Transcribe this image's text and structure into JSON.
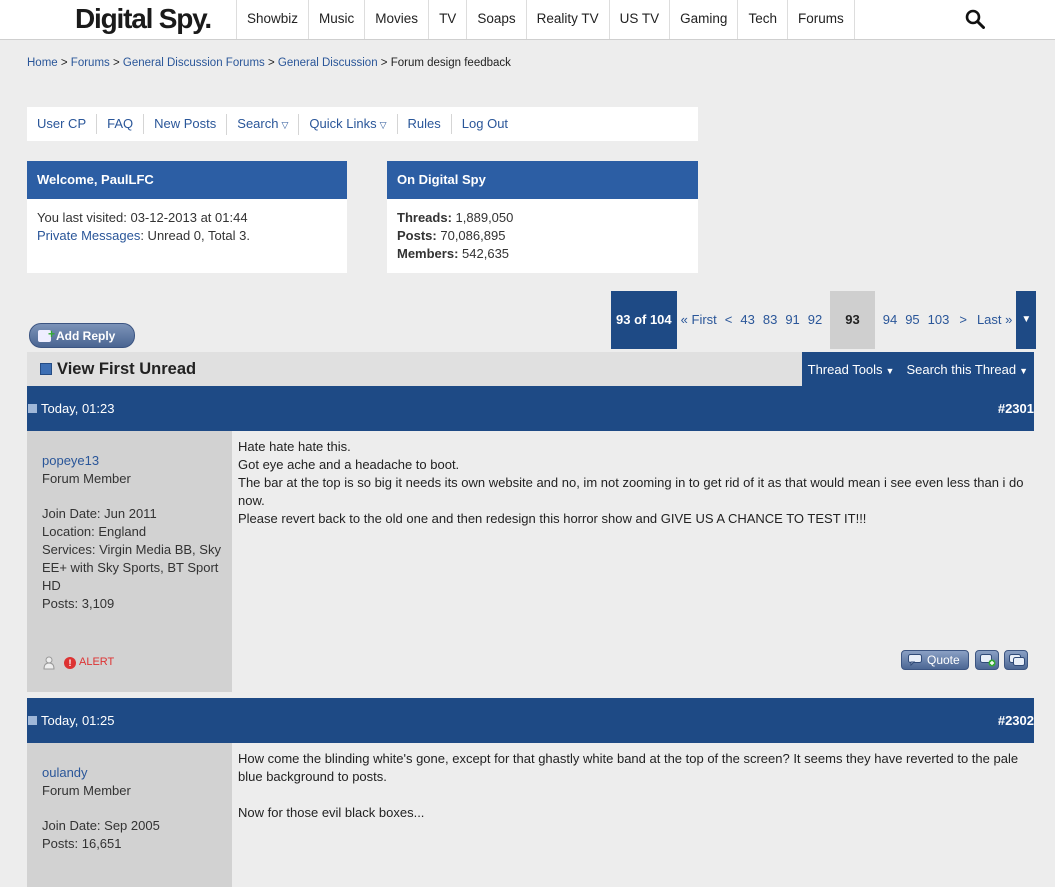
{
  "header": {
    "logo": "Digital Spy.",
    "nav": [
      "Showbiz",
      "Music",
      "Movies",
      "TV",
      "Soaps",
      "Reality TV",
      "US TV",
      "Gaming",
      "Tech",
      "Forums"
    ]
  },
  "breadcrumb": {
    "items": [
      "Home",
      "Forums",
      "General Discussion Forums",
      "General Discussion"
    ],
    "current": "Forum design feedback",
    "sep": " > "
  },
  "usermenu": {
    "items": [
      "User CP",
      "FAQ",
      "New Posts",
      "Search",
      "Quick Links",
      "Rules",
      "Log Out"
    ]
  },
  "welcome": {
    "title": "Welcome, PaulLFC",
    "last_visited_label": "You last visited: ",
    "last_visited": "03-12-2013 at 01:44",
    "pm_label": "Private Messages",
    "pm_value": ": Unread 0, Total 3."
  },
  "stats": {
    "title": "On Digital Spy",
    "threads_label": "Threads:",
    "threads": "1,889,050",
    "posts_label": "Posts:",
    "posts": "70,086,895",
    "members_label": "Members:",
    "members": "542,635"
  },
  "pager": {
    "count": "93 of 104",
    "first": "« First",
    "prev": "<",
    "pages_before": [
      "43",
      "83",
      "91",
      "92"
    ],
    "current": "93",
    "pages_after": [
      "94",
      "95",
      "103"
    ],
    "next": ">",
    "last": "Last »"
  },
  "add_reply": "Add Reply",
  "view_first_unread": "View First Unread",
  "tools": {
    "thread_tools": "Thread Tools",
    "search_thread": "Search this Thread"
  },
  "posts": [
    {
      "time": "Today, 01:23",
      "num": "#2301",
      "user": "popeye13",
      "rank": "Forum Member",
      "info": [
        "Join Date: Jun 2011",
        "Location: England",
        "Services: Virgin Media BB, Sky EE+ with Sky Sports, BT Sport HD",
        "Posts: 3,109"
      ],
      "body": [
        "Hate hate hate this.",
        "Got eye ache and a headache to boot.",
        "The bar at the top is so big it needs its own website and no, im not zooming in to get rid of it as that would mean i see even less than i do now.",
        "Please revert back to the old one and then redesign this horror show and GIVE US A CHANCE TO TEST IT!!!"
      ],
      "alert": "ALERT",
      "quote": "Quote"
    },
    {
      "time": "Today, 01:25",
      "num": "#2302",
      "user": "oulandy",
      "rank": "Forum Member",
      "info": [
        "Join Date: Sep 2005",
        "Posts: 16,651"
      ],
      "body": [
        "How come the blinding white's gone, except for that ghastly white band at the top of the screen? It seems they have reverted to the pale blue background to posts.",
        "",
        "Now for those evil black boxes..."
      ]
    }
  ]
}
